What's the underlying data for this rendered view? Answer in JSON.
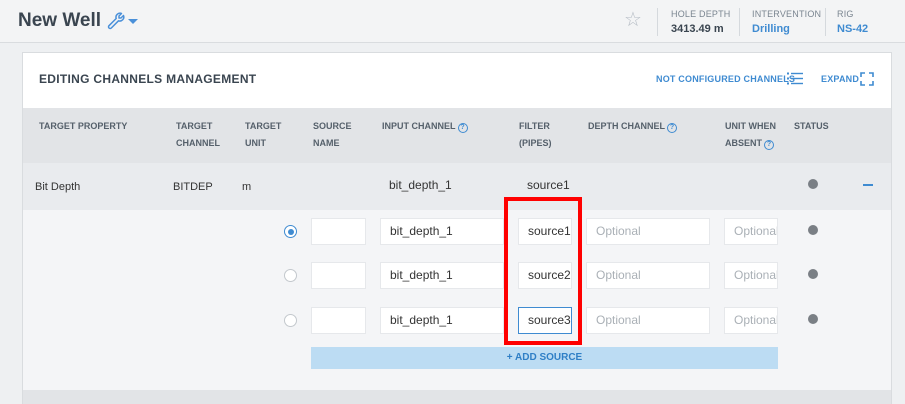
{
  "header": {
    "title": "New Well",
    "hole_depth_label": "HOLE DEPTH",
    "hole_depth_value": "3413.49 m",
    "intervention_label": "INTERVENTION",
    "intervention_value": "Drilling",
    "rig_label": "RIG",
    "rig_value": "NS-42"
  },
  "panel": {
    "title": "EDITING CHANNELS MANAGEMENT",
    "not_configured_label": "NOT CONFIGURED CHANNELS",
    "expand_label": "EXPAND"
  },
  "table": {
    "headers": {
      "target_property": "TARGET PROPERTY",
      "target_channel_1": "TARGET",
      "target_channel_2": "CHANNEL",
      "target_unit_1": "TARGET",
      "target_unit_2": "UNIT",
      "source_name_1": "SOURCE",
      "source_name_2": "NAME",
      "input_channel": "INPUT CHANNEL",
      "filter_1": "FILTER",
      "filter_2": "(PIPES)",
      "depth_channel": "DEPTH CHANNEL",
      "unit_absent_1": "UNIT WHEN",
      "unit_absent_2": "ABSENT",
      "status": "STATUS"
    },
    "main_row": {
      "target_property": "Bit Depth",
      "target_channel": "BITDEP",
      "target_unit": "m",
      "input_channel": "bit_depth_1",
      "filter": "source1"
    },
    "sources": [
      {
        "selected": true,
        "input_channel": "bit_depth_1",
        "filter": "source1",
        "depth_placeholder": "Optional",
        "unit_placeholder": "Optional"
      },
      {
        "selected": false,
        "input_channel": "bit_depth_1",
        "filter": "source2",
        "depth_placeholder": "Optional",
        "unit_placeholder": "Optional"
      },
      {
        "selected": false,
        "input_channel": "bit_depth_1",
        "filter": "source3",
        "depth_placeholder": "Optional",
        "unit_placeholder": "Optional"
      }
    ],
    "add_source_label": "+ ADD SOURCE"
  },
  "colors": {
    "accent": "#3f8bd1",
    "highlight": "#ff0000",
    "status_dot": "#7a7f85"
  }
}
